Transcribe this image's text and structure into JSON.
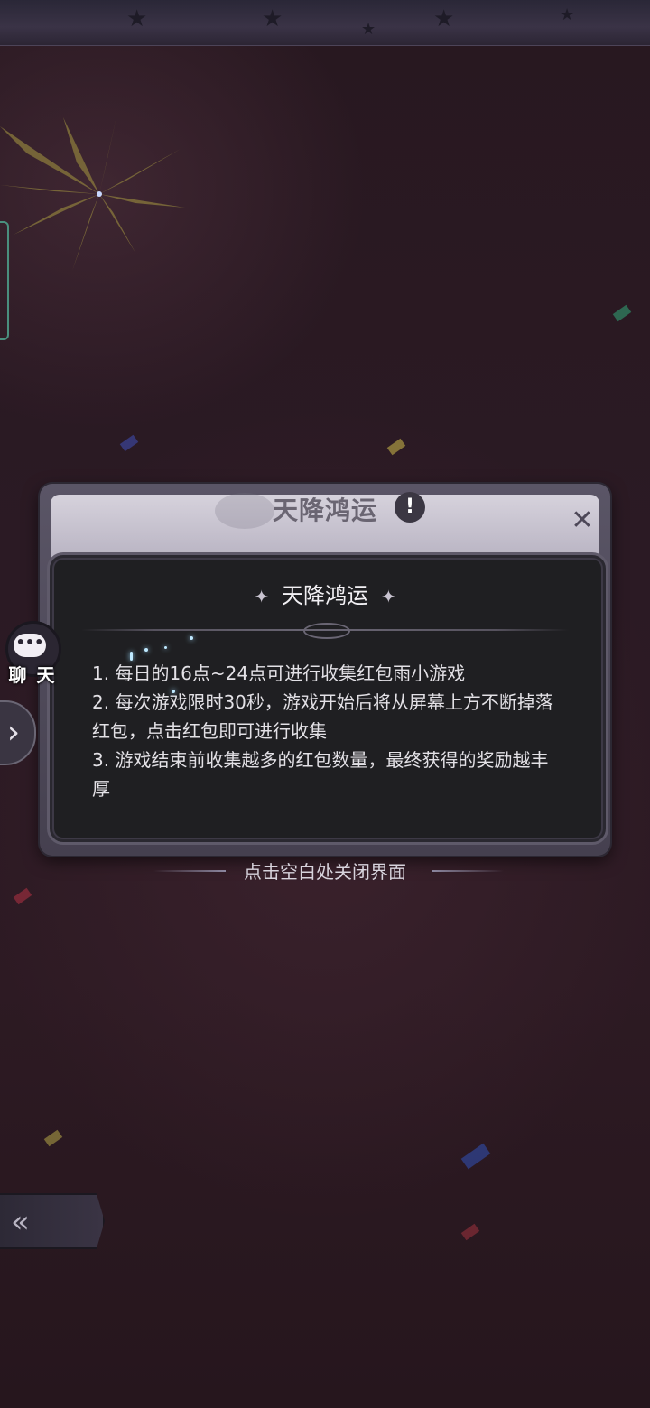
{
  "dialog": {
    "header_title": "天降鸿运",
    "info_icon": "!",
    "close_icon": "✕",
    "panel_title": "天降鸿运",
    "rules": [
      "1. 每日的16点~24点可进行收集红包雨小游戏",
      "2. 每次游戏限时30秒，游戏开始后将从屏幕上方不断掉落红包，点击红包即可进行收集",
      "3. 游戏结束前收集越多的红包数量，最终获得的奖励越丰厚"
    ],
    "close_hint": "点击空白处关闭界面"
  },
  "chat": {
    "label": "聊 天",
    "bubble": "•••"
  },
  "side_controls": {
    "expand_arrow": "›",
    "back_icon": "«"
  },
  "colors": {
    "background": "#2a1a22",
    "panel": "#1f1f22",
    "frame": "#5a5566",
    "text": "#e3e1e6"
  },
  "icons": [
    "info-icon",
    "close-icon",
    "chat-bubble-icon",
    "chevron-right-icon",
    "back-icon"
  ]
}
